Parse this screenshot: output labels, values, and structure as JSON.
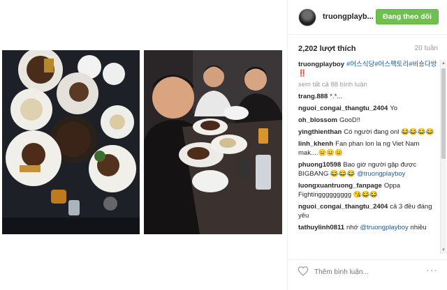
{
  "header": {
    "username": "truongplayb...",
    "follow_label": "Đang theo dõi"
  },
  "stats": {
    "likes": "2,202 lượt thích",
    "age": "20 tuần"
  },
  "caption": {
    "user": "truongplayboy",
    "text": "#어스식당#어스팩토리#비숑다방 ‼️"
  },
  "view_all": "xem tất cả 88 bình luận",
  "comments": [
    {
      "user": "trang.888",
      "text": "*.*..."
    },
    {
      "user": "nguoi_congai_thangtu_2404",
      "text": "Yo"
    },
    {
      "user": "oh_blossom",
      "text": "GooD!!"
    },
    {
      "user": "yingthienthan",
      "text": "Có người đang onl 😂😂😂😂"
    },
    {
      "user": "linh_khenh",
      "text": "Fan phan lon la ng Viet Nam mak....😐😐😐"
    },
    {
      "user": "phuong10598",
      "text": "Bao giờ người gặp được BIGBANG 😂😂😂",
      "mention": "@truongplayboy"
    },
    {
      "user": "luongxuantruong_fanpage",
      "text": "Oppa Fightinggggggggg 😘😂😂"
    },
    {
      "user": "nguoi_congai_thangtu_2404",
      "text": "cả 3 đều đáng yêu"
    },
    {
      "user": "tathuylinh0811",
      "text": "nhớ",
      "mention": "@truongplayboy",
      "tail": "nhiều"
    }
  ],
  "footer": {
    "add_comment_placeholder": "Thêm bình luận...",
    "more_label": "···"
  },
  "colors": {
    "follow_button": "#70c050",
    "link": "#1e5a94"
  },
  "icons": {
    "like": "heart-icon",
    "options": "more-options-icon"
  }
}
